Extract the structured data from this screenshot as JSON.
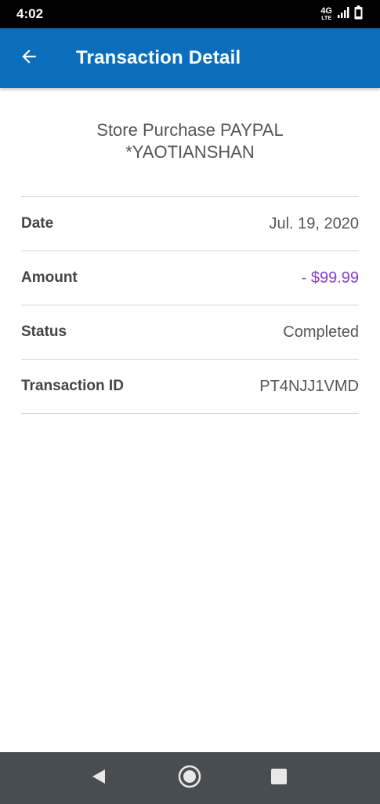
{
  "status_bar": {
    "time": "4:02",
    "network": "4G",
    "network_sub": "LTE"
  },
  "app_bar": {
    "title": "Transaction Detail"
  },
  "merchant": {
    "line1": "Store Purchase PAYPAL",
    "line2": "*YAOTIANSHAN"
  },
  "details": {
    "date_label": "Date",
    "date_value": "Jul. 19, 2020",
    "amount_label": "Amount",
    "amount_value": "- $99.99",
    "status_label": "Status",
    "status_value": "Completed",
    "transaction_id_label": "Transaction ID",
    "transaction_id_value": "PT4NJJ1VMD"
  },
  "colors": {
    "app_bar": "#0a6ebd",
    "amount": "#8a3fc9",
    "nav_bar": "#474d51"
  },
  "icons": {
    "back": "arrow-left-icon",
    "signal": "cell-signal-icon",
    "battery": "battery-icon",
    "nav_back": "triangle-back-icon",
    "nav_home": "circle-home-icon",
    "nav_recents": "square-recents-icon"
  }
}
